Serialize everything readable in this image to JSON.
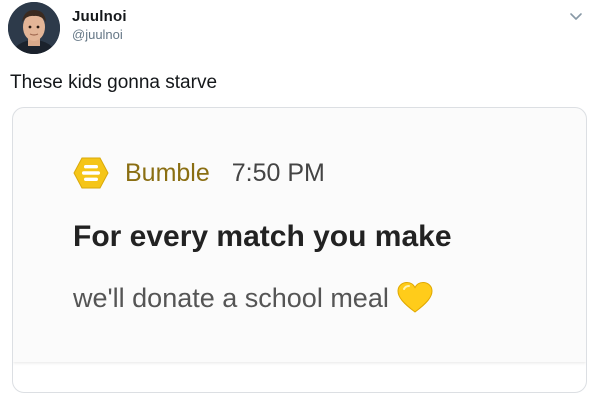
{
  "tweet": {
    "author_name": "Juulnoi",
    "author_handle": "@juulnoi",
    "text": "These kids gonna starve",
    "avatar_icon": "profile-photo",
    "menu_icon": "chevron-down-icon"
  },
  "notification": {
    "app_name": "Bumble",
    "app_icon": "bumble-logo-icon",
    "time": "7:50 PM",
    "title": "For every match you make",
    "body": "we'll donate a school meal",
    "emoji_icon": "yellow-heart-icon"
  },
  "colors": {
    "bumble_yellow": "#f5c518",
    "app_name_color": "#8a6e12",
    "handle_gray": "#657786"
  }
}
